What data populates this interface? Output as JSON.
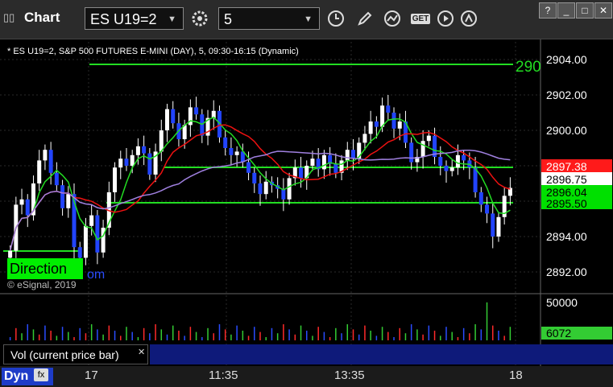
{
  "window": {
    "title": "Chart",
    "symbol": "ES U19=2",
    "interval": "5",
    "get_label": "GET",
    "buttons": [
      "minimize",
      "restore",
      "maximize",
      "close"
    ]
  },
  "chart": {
    "header": "* ES U19=2, S&P 500 FUTURES E-MINI (DAY), 5, 09:30-16:15 (Dynamic)",
    "watermark": "© eSignal, 2019",
    "direction_label": "Direction",
    "om_label": "om",
    "level_label_partial": "290",
    "price_axis": [
      "2904.00",
      "2902.00",
      "2900.00",
      "2898.00",
      "2896.00",
      "2894.00",
      "2892.00"
    ],
    "price_tags": [
      {
        "value": "2897.38",
        "color": "#ff1a1a",
        "text_color": "#ffffff"
      },
      {
        "value": "2896.75",
        "color": "#ffffff",
        "text_color": "#000000"
      },
      {
        "value": "2896.04",
        "color": "#00e000",
        "text_color": "#000000"
      },
      {
        "value": "2895.50",
        "color": "#00e000",
        "text_color": "#000000"
      }
    ],
    "volume_axis": [
      "50000"
    ],
    "volume_tag": {
      "value": "6072",
      "color": "#33cc33"
    },
    "volume_panel_label": "Vol (current price bar)",
    "time_axis": [
      "17",
      "11:35",
      "13:35",
      "18"
    ],
    "bottom_label": "Dyn",
    "colors": {
      "up": "#ffffff",
      "down": "#2244ff",
      "grid": "#333333",
      "ma_fast": "#22dd22",
      "ma_mid": "#ee1111",
      "ma_slow": "#a080e0",
      "level": "#22dd22"
    }
  },
  "chart_data": {
    "type": "candlestick",
    "title": "* ES U19=2, S&P 500 FUTURES E-MINI (DAY), 5, 09:30-16:15 (Dynamic)",
    "ylim": [
      2891.0,
      2905.0
    ],
    "last": 2896.75,
    "levels": [
      2902.75,
      2897.3,
      2895.5,
      2892.9
    ],
    "moving_averages": {
      "fast": "green",
      "mid": "red",
      "slow": "purple"
    },
    "volume_latest": 6072
  }
}
